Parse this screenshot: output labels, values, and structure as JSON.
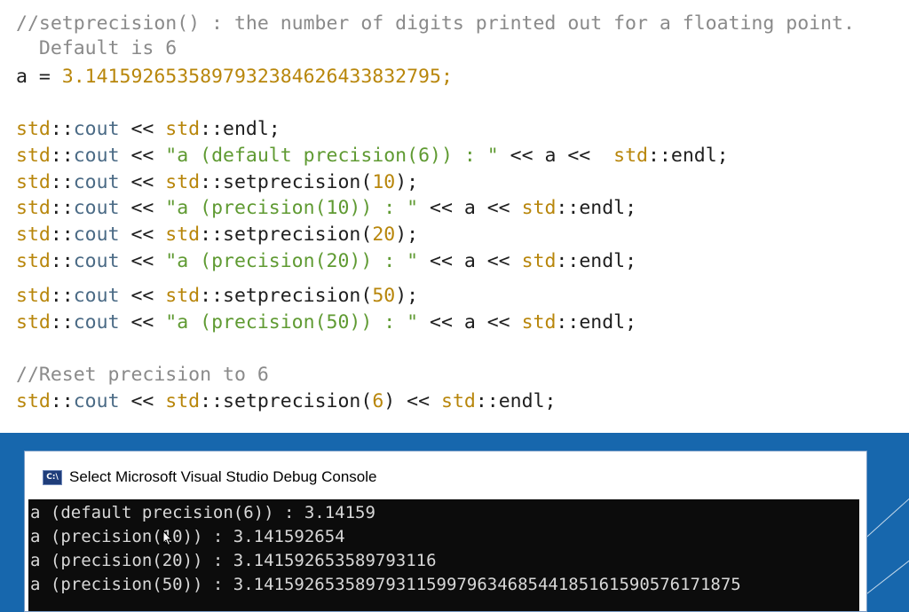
{
  "code": {
    "comment_line1": "//setprecision() : the number of digits printed out for a floating point.",
    "comment_line2": "  Default is 6",
    "assign": {
      "lhs": "a = ",
      "value": "3.141592653589793238462643383279",
      "end": "5;"
    },
    "lines": [
      {
        "ns": "std",
        "sep": "::",
        "kw": "cout",
        "op": " << ",
        "ns2": "std",
        "sep2": "::",
        "rest": "endl;"
      },
      {
        "ns": "std",
        "sep": "::",
        "kw": "cout",
        "op": " << ",
        "str": "\"a (default precision(6)) : \"",
        "tail1": " << a <<  ",
        "ns2": "std",
        "sep2": "::",
        "rest": "endl;"
      },
      {
        "ns": "std",
        "sep": "::",
        "kw": "cout",
        "op": " << ",
        "ns2": "std",
        "sep2": "::",
        "rest": "setprecision(",
        "num": "10",
        "close": ");"
      },
      {
        "ns": "std",
        "sep": "::",
        "kw": "cout",
        "op": " << ",
        "str": "\"a (precision(10)) : \"",
        "tail1": " << a << ",
        "ns2": "std",
        "sep2": "::",
        "rest": "endl;"
      },
      {
        "ns": "std",
        "sep": "::",
        "kw": "cout",
        "op": " << ",
        "ns2": "std",
        "sep2": "::",
        "rest": "setprecision(",
        "num": "20",
        "close": ");"
      },
      {
        "ns": "std",
        "sep": "::",
        "kw": "cout",
        "op": " << ",
        "str": "\"a (precision(20)) : \"",
        "tail1": " << a << ",
        "ns2": "std",
        "sep2": "::",
        "rest": "endl;"
      },
      {
        "ns": "std",
        "sep": "::",
        "kw": "cout",
        "op": " << ",
        "ns2": "std",
        "sep2": "::",
        "rest": "setprecision(",
        "num": "50",
        "close": ");"
      },
      {
        "ns": "std",
        "sep": "::",
        "kw": "cout",
        "op": " << ",
        "str": "\"a (precision(50)) : \"",
        "tail1": " << a << ",
        "ns2": "std",
        "sep2": "::",
        "rest": "endl;"
      }
    ],
    "reset_comment": "//Reset precision to 6",
    "reset_line": {
      "ns": "std",
      "sep": "::",
      "kw": "cout",
      "op": " << ",
      "ns2": "std",
      "sep2": "::",
      "rest": "setprecision(",
      "num": "6",
      "close": ")",
      "tail": " << ",
      "ns3": "std",
      "sep3": "::",
      "end": "endl;"
    }
  },
  "console": {
    "title": "Select Microsoft Visual Studio Debug Console",
    "icon_label": "C:\\",
    "output": [
      "a (default precision(6)) : 3.14159",
      "a (precision(10)) : 3.141592654",
      "a (precision(20)) : 3.141592653589793116",
      "a (precision(50)) : 3.141592653589793115997963468544185161590576171875"
    ]
  }
}
